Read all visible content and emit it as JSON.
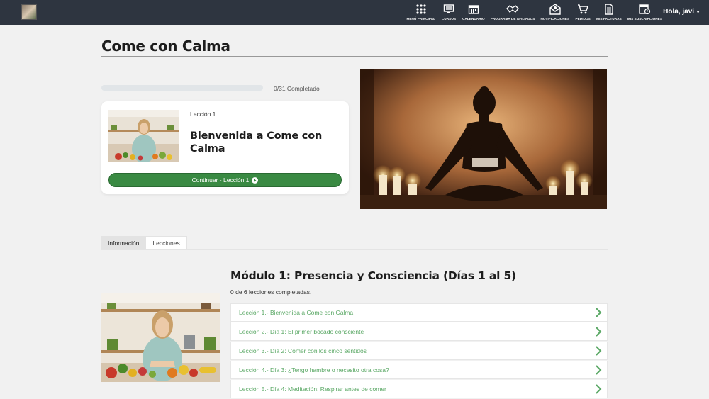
{
  "header": {
    "nav": [
      {
        "label": "MENÚ PRINCIPAL",
        "icon": "grid-icon"
      },
      {
        "label": "CURSOS",
        "icon": "monitor-icon"
      },
      {
        "label": "CALENDARIO",
        "icon": "calendar-icon"
      },
      {
        "label": "PROGRAMA DE AFILIADOS",
        "icon": "handshake-icon"
      },
      {
        "label": "NOTIFICACIONES",
        "icon": "envelope-icon"
      },
      {
        "label": "PEDIDOS",
        "icon": "cart-icon"
      },
      {
        "label": "MIS FACTURAS",
        "icon": "document-icon"
      },
      {
        "label": "MIS SUSCRIPCIONES",
        "icon": "subscription-icon"
      }
    ],
    "user_greeting": "Hola, javi"
  },
  "course": {
    "title": "Come con Calma",
    "progress_text": "0/31 Completado",
    "progress_fraction": 0
  },
  "current_lesson": {
    "number_label": "Lección 1",
    "title": "Bienvenida a Come con Calma",
    "button_label": "Continuar - Lección 1"
  },
  "tabs": [
    {
      "label": "Información",
      "active": true
    },
    {
      "label": "Lecciones",
      "active": false
    }
  ],
  "module": {
    "title": "Módulo 1: Presencia y Consciencia (Días 1 al 5)",
    "progress_text": "0 de 6 lecciones completadas.",
    "lessons": [
      "Lección 1.- Bienvenida a Come con Calma",
      "Lección 2.- Día 1: El primer bocado consciente",
      "Lección 3.- Día 2: Comer con los cinco sentidos",
      "Lección 4.- Día 3: ¿Tengo hambre o necesito otra cosa?",
      "Lección 5.- Día 4: Meditación: Respirar antes de comer"
    ]
  },
  "colors": {
    "topbar": "#2e3540",
    "accent_green": "#3a8a43",
    "lesson_link": "#5aa865"
  }
}
